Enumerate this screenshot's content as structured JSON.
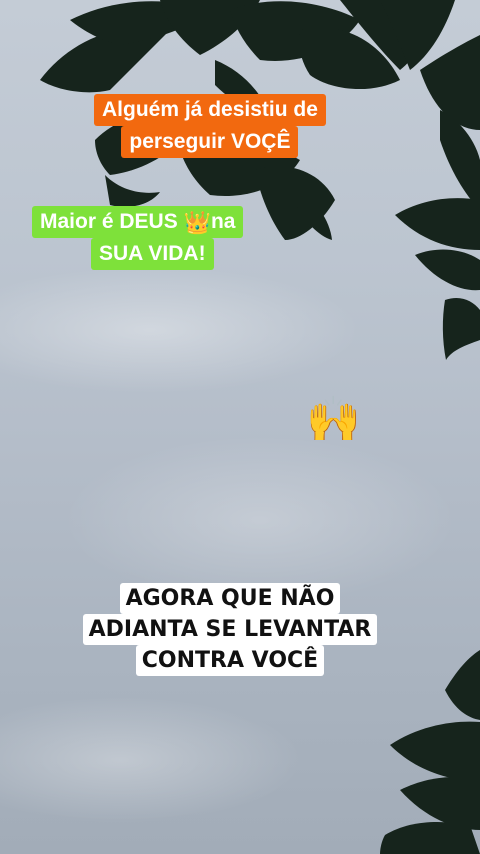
{
  "captions": {
    "top": {
      "line1": "Alguém já desistiu de",
      "line2": "perseguir VOÇÊ",
      "bg": "#f2690f"
    },
    "middle": {
      "line1_a": "Maior é DEUS ",
      "emoji": "👑",
      "line1_b": "na",
      "line2": "SUA VIDA!",
      "bg": "#7ee13a"
    },
    "reaction_emoji": "🙌",
    "bottom": {
      "line1": "AGORA QUE NÃO",
      "line2": "ADIANTA SE LEVANTAR",
      "line3": "CONTRA VOCÊ",
      "bg": "#ffffff"
    }
  },
  "scene": {
    "sky": "#bcc5d0",
    "foliage": "#16241c"
  }
}
